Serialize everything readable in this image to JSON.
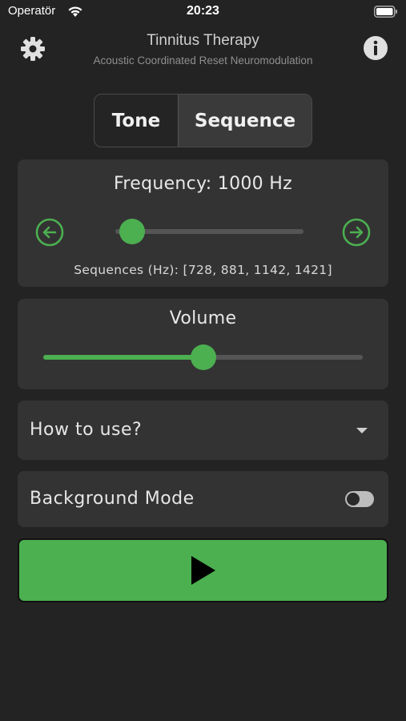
{
  "status_bar": {
    "carrier": "Operatör",
    "time": "20:23"
  },
  "header": {
    "title": "Tinnitus Therapy",
    "subtitle": "Acoustic Coordinated Reset Neuromodulation",
    "left_icon": "gear-icon",
    "right_icon": "info-icon"
  },
  "mode_tabs": [
    {
      "label": "Tone",
      "selected": false
    },
    {
      "label": "Sequence",
      "selected": true
    }
  ],
  "frequency": {
    "label": "Frequency: 1000 Hz",
    "slider_fraction": 0.09,
    "sequences_label": "Sequences (Hz): [728, 881, 1142, 1421]"
  },
  "volume": {
    "label": "Volume",
    "slider_fraction": 0.5
  },
  "how_to_use": {
    "label": "How to use?"
  },
  "background_mode": {
    "label": "Background Mode",
    "enabled": false
  },
  "play_button": {
    "icon": "play-icon"
  },
  "colors": {
    "accent": "#4caf50",
    "background": "#232323",
    "card": "#333333"
  }
}
